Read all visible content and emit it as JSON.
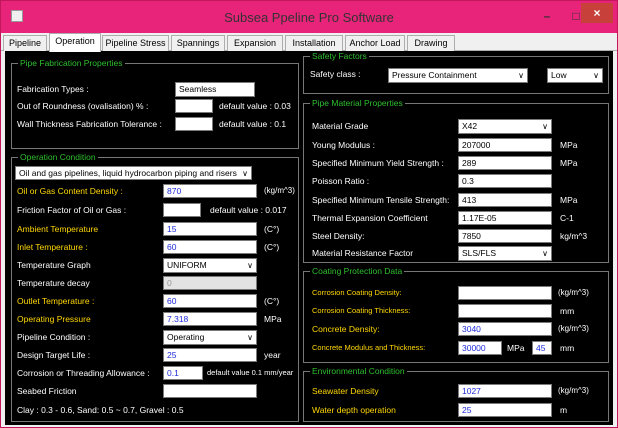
{
  "window": {
    "title": "Subsea Ppeline Pro Software",
    "minimize": "–",
    "maximize": "□",
    "close": "×"
  },
  "tabs": [
    "Pipeline",
    "Operation",
    "Pipeline Stress",
    "Spannings",
    "Expansion",
    "Installation",
    "Anchor Load",
    "Drawing"
  ],
  "active_tab": "Operation",
  "fab": {
    "title": "Pipe Fabrication Properties",
    "types_label": "Fabrication Types :",
    "types_value": "Seamless",
    "oor_label": "Out of Roundness (ovalisation) % :",
    "oor_default": "default value : 0.03",
    "wt_label": "Wall Thickness Fabrication Tolerance :",
    "wt_default": "default value : 0.1"
  },
  "op": {
    "title": "Operation Condition",
    "service_value": "Oil and gas pipelines, liquid hydrocarbon piping and risers",
    "density_label": "Oil or Gas Content Density :",
    "density_value": "870",
    "density_unit": "(kg/m^3)",
    "friction_label": "Friction Factor of Oil or Gas :",
    "friction_default": "default value : 0.017",
    "ambient_label": "Ambient Temperature",
    "ambient_value": "15",
    "ambient_unit": "(C°)",
    "inlet_label": "Inlet Temperature :",
    "inlet_value": "60",
    "inlet_unit": "(C°)",
    "graph_label": "Temperature Graph",
    "graph_value": "UNIFORM",
    "decay_label": "Temperature decay",
    "decay_value": "0",
    "outlet_label": "Outlet Temperature :",
    "outlet_value": "60",
    "outlet_unit": "(C°)",
    "pressure_label": "Operating Pressure",
    "pressure_value": "7.318",
    "pressure_unit": "MPa",
    "condition_label": "Pipeline Condition :",
    "condition_value": "Operating",
    "life_label": "Design Target Life :",
    "life_value": "25",
    "life_unit": "year",
    "corr_label": "Corrosion or Threading Allowance :",
    "corr_value": "0.1",
    "corr_default": "default value 0.1 mm/year",
    "seabed_label": "Seabed Friction",
    "seabed_note": "Clay : 0.3 - 0.6, Sand: 0.5 ~ 0.7, Gravel : 0.5"
  },
  "safety": {
    "title": "Safety Factors",
    "class_label": "Safety class :",
    "class_value": "Pressure Containment",
    "level_value": "Low"
  },
  "mat": {
    "title": "Pipe Material Properties",
    "grade_label": "Material Grade",
    "grade_value": "X42",
    "young_label": "Young Modulus :",
    "young_value": "207000",
    "young_unit": "MPa",
    "smys_label": "Specified Minimum Yield Strength :",
    "smys_value": "289",
    "smys_unit": "MPa",
    "poisson_label": "Poisson Ratio :",
    "poisson_value": "0.3",
    "smts_label": "Specified Minimum Tensile Strength:",
    "smts_value": "413",
    "smts_unit": "MPa",
    "thermal_label": "Thermal Expansion Coefficient",
    "thermal_value": "1.17E-05",
    "thermal_unit": "C-1",
    "steel_label": "Steel Density:",
    "steel_value": "7850",
    "steel_unit": "kg/m^3",
    "factor_label": "Material Resistance Factor",
    "factor_value": "SLS/FLS"
  },
  "coat": {
    "title": "Coating Protection Data",
    "cdens_label": "Corrosion Coating Density:",
    "cdens_unit": "(kg/m^3)",
    "cthick_label": "Corrosion Coating Thickness:",
    "cthick_unit": "mm",
    "concrete_label": "Concrete Density:",
    "concrete_value": "3040",
    "concrete_unit": "(kg/m^3)",
    "cmod_label": "Concrete Modulus and Thickness:",
    "cmod_value": "30000",
    "cmod_mid": "MPa",
    "cmod_thick": "45",
    "cmod_unit": "mm"
  },
  "env": {
    "title": "Environmental Condition",
    "sea_label": "Seawater Density",
    "sea_value": "1027",
    "sea_unit": "(kg/m^3)",
    "depth_label": "Water depth operation",
    "depth_value": "25",
    "depth_unit": "m"
  }
}
